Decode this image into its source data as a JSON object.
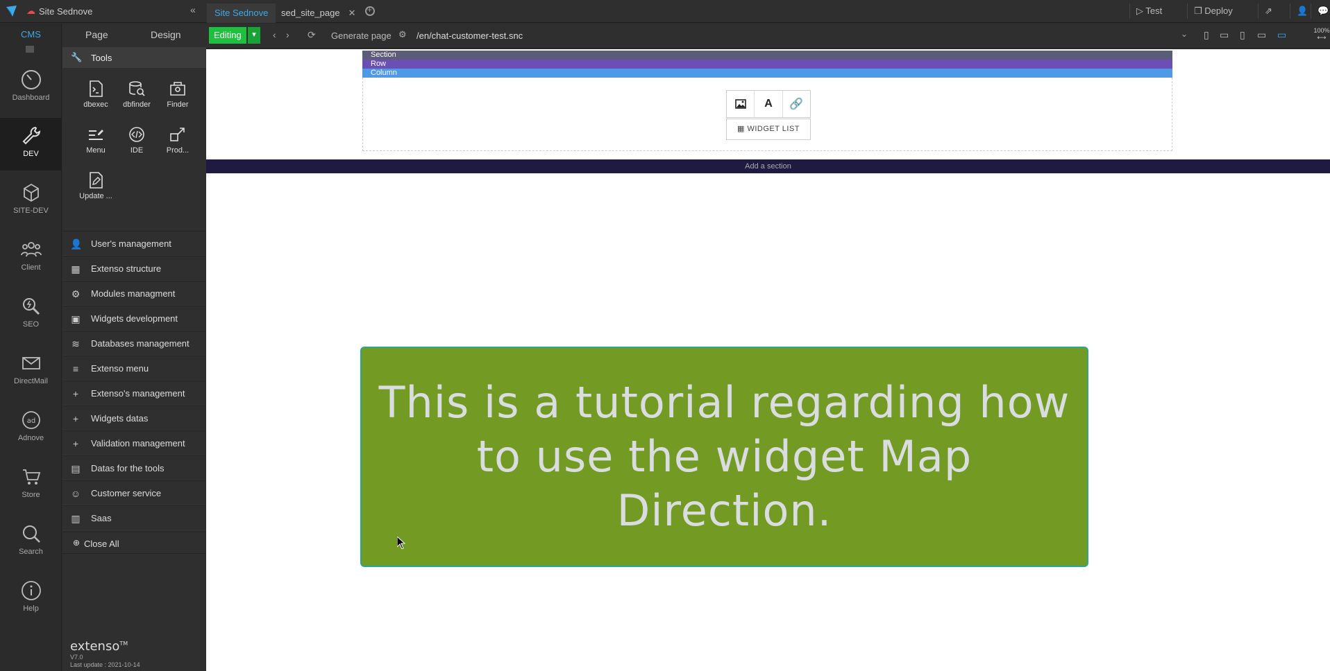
{
  "topbar": {
    "site_title": "Site Sednove",
    "tabs": [
      {
        "label": "Site Sednove",
        "active": true
      },
      {
        "label": "sed_site_page",
        "active": false
      }
    ],
    "test_label": "Test",
    "deploy_label": "Deploy"
  },
  "addressbar": {
    "mode": "Editing",
    "generate_page": "Generate page",
    "url": "/en/chat-customer-test.snc",
    "zoom": "100%"
  },
  "rail": {
    "cms_label": "CMS",
    "items": [
      {
        "label": "Dashboard",
        "icon": "gauge-icon"
      },
      {
        "label": "DEV",
        "icon": "wrench-icon",
        "active": true
      },
      {
        "label": "SITE-DEV",
        "icon": "cube-icon"
      },
      {
        "label": "Client",
        "icon": "users-icon"
      },
      {
        "label": "SEO",
        "icon": "seo-search-icon"
      },
      {
        "label": "DirectMail",
        "icon": "mail-icon"
      },
      {
        "label": "Adnove",
        "icon": "ad-icon"
      },
      {
        "label": "Store",
        "icon": "cart-icon"
      },
      {
        "label": "Search",
        "icon": "search-icon"
      },
      {
        "label": "Help",
        "icon": "info-icon"
      }
    ]
  },
  "panel": {
    "tabs": [
      "Page",
      "Design"
    ],
    "tools_title": "Tools",
    "tools": [
      {
        "label": "dbexec",
        "icon": "terminal-icon"
      },
      {
        "label": "dbfinder",
        "icon": "db-search-icon"
      },
      {
        "label": "Finder",
        "icon": "finder-icon"
      },
      {
        "label": "Menu",
        "icon": "menu-edit-icon"
      },
      {
        "label": "IDE",
        "icon": "code-icon"
      },
      {
        "label": "Prod...",
        "icon": "external-link-icon"
      },
      {
        "label": "Update ...",
        "icon": "file-edit-icon"
      }
    ],
    "menu": [
      {
        "label": "User's management",
        "icon": "user-icon",
        "glyph": "👤"
      },
      {
        "label": "Extenso structure",
        "icon": "structure-icon",
        "glyph": "▦"
      },
      {
        "label": "Modules managment",
        "icon": "modules-icon",
        "glyph": "⚙"
      },
      {
        "label": "Widgets development",
        "icon": "widgets-icon",
        "glyph": "▣"
      },
      {
        "label": "Databases management",
        "icon": "database-icon",
        "glyph": "≋"
      },
      {
        "label": "Extenso menu",
        "icon": "bars-icon",
        "glyph": "≡"
      },
      {
        "label": "Extenso's management",
        "icon": "plus-icon",
        "glyph": "+"
      },
      {
        "label": "Widgets datas",
        "icon": "plus-icon",
        "glyph": "+"
      },
      {
        "label": "Validation management",
        "icon": "plus-icon",
        "glyph": "+"
      },
      {
        "label": "Datas for the tools",
        "icon": "data-tools-icon",
        "glyph": "▤"
      },
      {
        "label": "Customer service",
        "icon": "group-icon",
        "glyph": "☺"
      },
      {
        "label": "Saas",
        "icon": "building-icon",
        "glyph": "▥"
      }
    ],
    "close_all": "Close All",
    "brand": "extenso",
    "brand_tm": "TM",
    "version": "V7.0",
    "last_update": "Last update : 2021-10-14"
  },
  "canvas": {
    "bars": {
      "section": "Section",
      "row": "Row",
      "column": "Column"
    },
    "widget_list": "WIDGET LIST",
    "add_section": "Add a section",
    "hero_text": "This is a tutorial regarding how to use the widget Map Direction.",
    "hero_bg": "#739a23"
  }
}
